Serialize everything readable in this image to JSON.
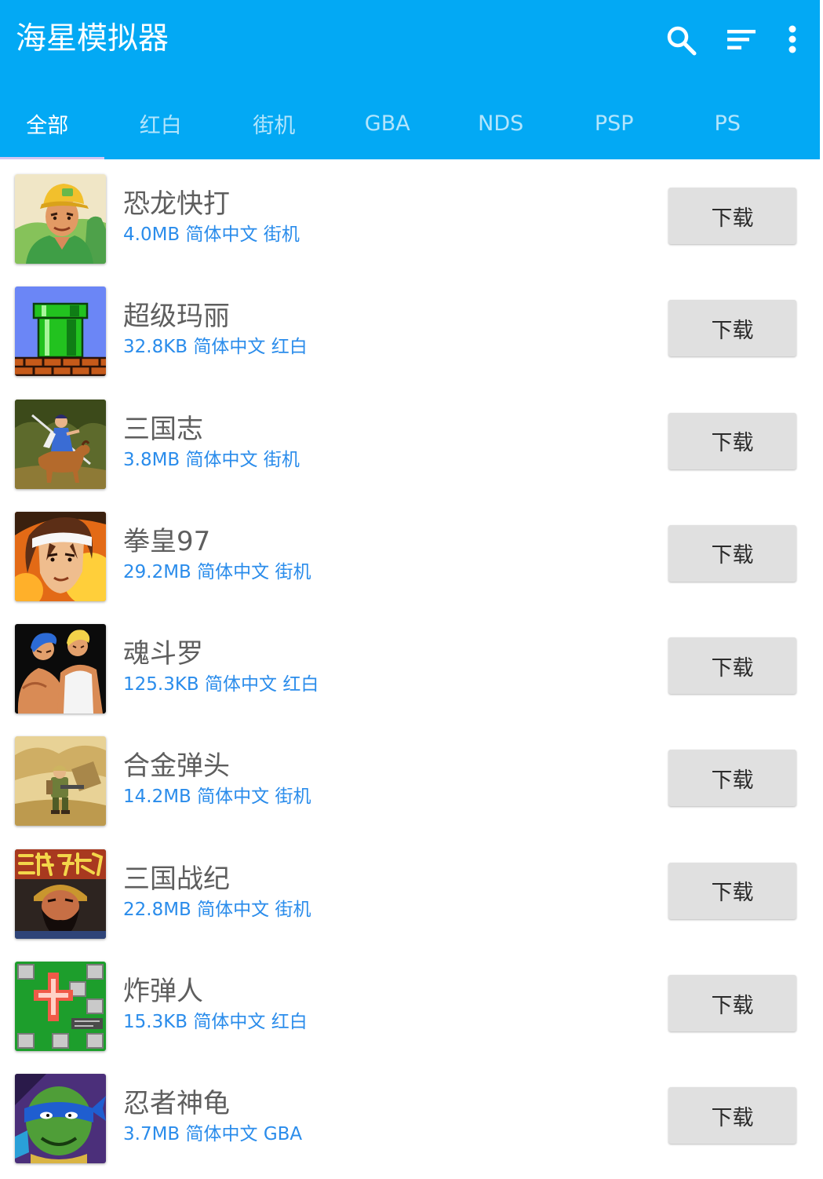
{
  "app": {
    "title": "海星模拟器"
  },
  "theme": {
    "accent_color": "#03A9F4",
    "title_text_color": "#5E5E5E",
    "meta_text_color": "#2A8CEB",
    "button_color": "#E0E0E0"
  },
  "toolbar": {
    "actions": [
      {
        "icon": "search-icon"
      },
      {
        "icon": "sort-icon"
      },
      {
        "icon": "more-vert-icon"
      }
    ]
  },
  "tabs": [
    {
      "label": "全部",
      "active": true
    },
    {
      "label": "红白",
      "active": false
    },
    {
      "label": "街机",
      "active": false
    },
    {
      "label": "GBA",
      "active": false
    },
    {
      "label": "NDS",
      "active": false
    },
    {
      "label": "PSP",
      "active": false
    },
    {
      "label": "PS",
      "active": false
    }
  ],
  "game_list": {
    "items": [
      {
        "title": "恐龙快打",
        "size": "4.0MB",
        "language": "简体中文",
        "category": "街机",
        "action_label": "下载",
        "cover": "soldier-cap-portrait-cover"
      },
      {
        "title": "超级玛丽",
        "size": "32.8KB",
        "language": "简体中文",
        "category": "红白",
        "action_label": "下载",
        "cover": "green-pipe-bricks-cover"
      },
      {
        "title": "三国志",
        "size": "3.8MB",
        "language": "简体中文",
        "category": "街机",
        "action_label": "下载",
        "cover": "mounted-warrior-cover"
      },
      {
        "title": "拳皇97",
        "size": "29.2MB",
        "language": "简体中文",
        "category": "街机",
        "action_label": "下载",
        "cover": "headband-fighter-cover"
      },
      {
        "title": "魂斗罗",
        "size": "125.3KB",
        "language": "简体中文",
        "category": "红白",
        "action_label": "下载",
        "cover": "two-commandos-cover"
      },
      {
        "title": "合金弹头",
        "size": "14.2MB",
        "language": "简体中文",
        "category": "街机",
        "action_label": "下载",
        "cover": "desert-soldier-cover"
      },
      {
        "title": "三国战纪",
        "size": "22.8MB",
        "language": "简体中文",
        "category": "街机",
        "action_label": "下载",
        "cover": "bearded-general-cover"
      },
      {
        "title": "炸弹人",
        "size": "15.3KB",
        "language": "简体中文",
        "category": "红白",
        "action_label": "下载",
        "cover": "bomb-grid-cover"
      },
      {
        "title": "忍者神龟",
        "size": "3.7MB",
        "language": "简体中文",
        "category": "GBA",
        "action_label": "下载",
        "cover": "ninja-turtle-cover"
      }
    ]
  }
}
